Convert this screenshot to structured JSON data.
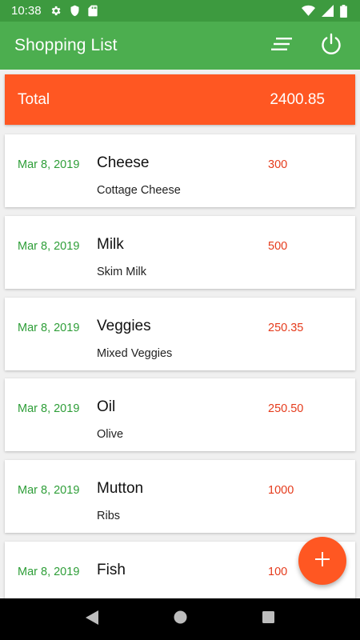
{
  "status_bar": {
    "time": "10:38",
    "icons": [
      "gear-icon",
      "shield-icon",
      "sd-card-icon",
      "wifi-icon",
      "cell-signal-icon",
      "battery-icon"
    ]
  },
  "app_bar": {
    "title": "Shopping List",
    "actions": [
      "sort-icon",
      "power-icon"
    ]
  },
  "total": {
    "label": "Total",
    "value": "2400.85"
  },
  "items": [
    {
      "date": "Mar 8, 2019",
      "name": "Cheese",
      "description": "Cottage Cheese",
      "price": "300"
    },
    {
      "date": "Mar 8, 2019",
      "name": "Milk",
      "description": "Skim Milk",
      "price": "500"
    },
    {
      "date": "Mar 8, 2019",
      "name": "Veggies",
      "description": "Mixed Veggies",
      "price": "250.35"
    },
    {
      "date": "Mar 8, 2019",
      "name": "Oil",
      "description": "Olive",
      "price": "250.50"
    },
    {
      "date": "Mar 8, 2019",
      "name": "Mutton",
      "description": "Ribs",
      "price": "1000"
    },
    {
      "date": "Mar 8, 2019",
      "name": "Fish",
      "description": "",
      "price": "100"
    }
  ],
  "fab": {
    "icon": "plus-icon"
  },
  "nav_bar": {
    "buttons": [
      "back-icon",
      "home-icon",
      "recents-icon"
    ]
  },
  "colors": {
    "status_bar": "#3d9a3f",
    "app_bar": "#4cae4f",
    "accent": "#ff5722",
    "date_text": "#2e9e38",
    "price_text": "#e53b1c"
  }
}
